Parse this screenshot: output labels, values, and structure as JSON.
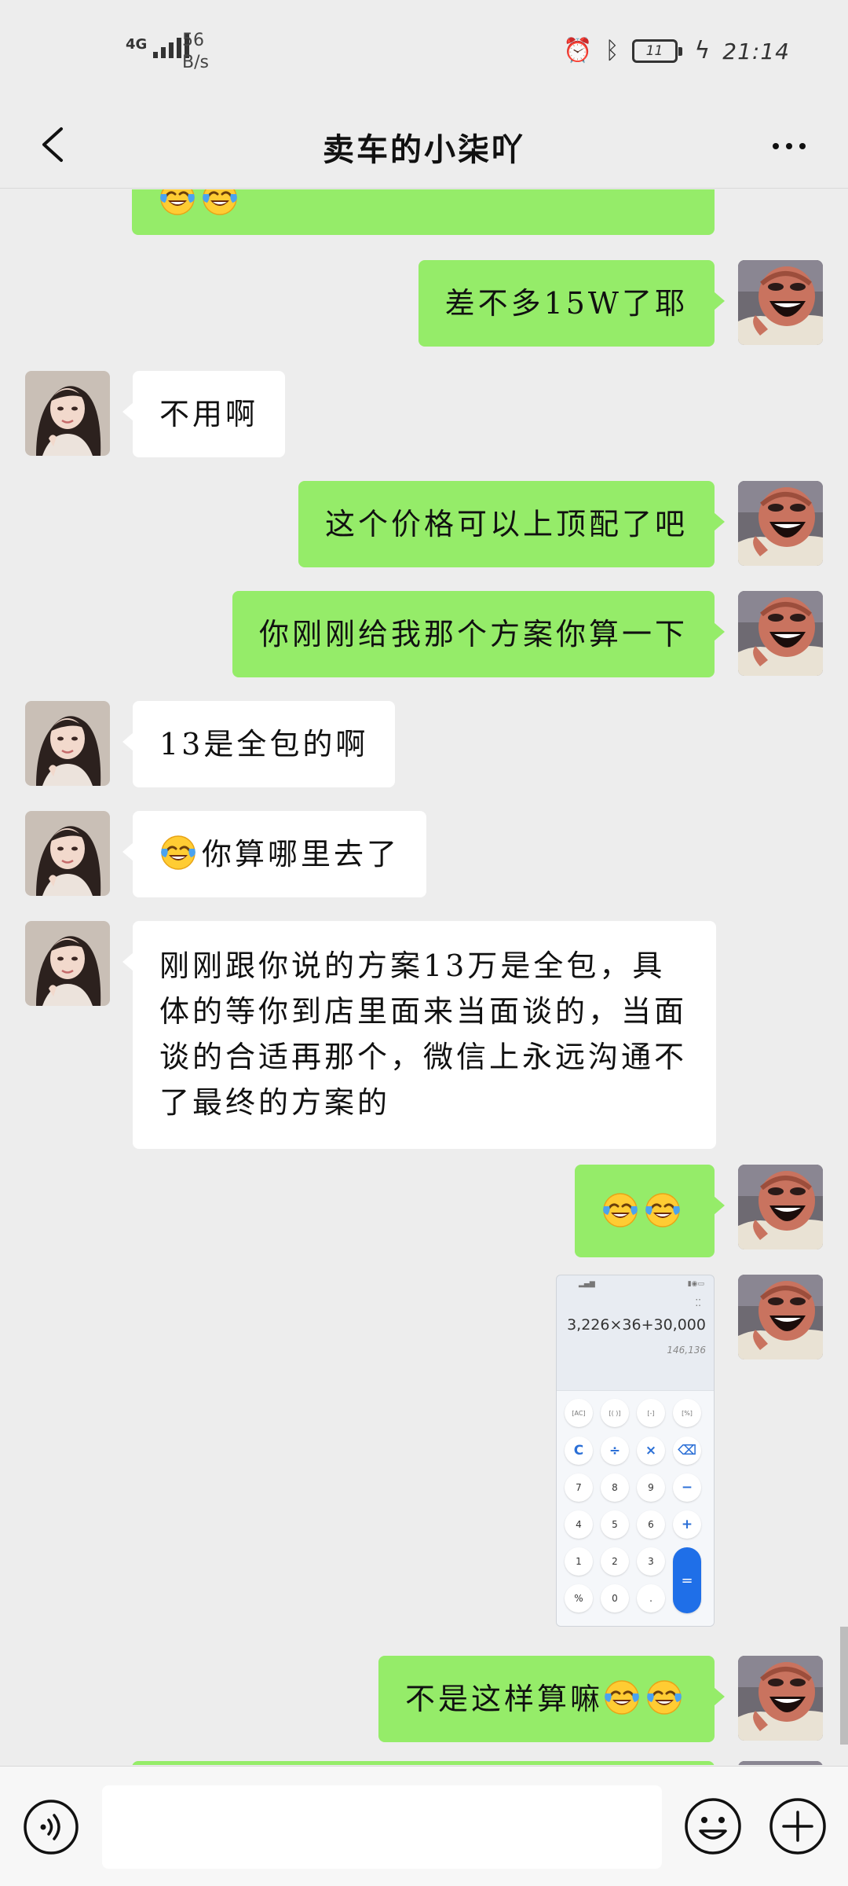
{
  "status_bar": {
    "network_type": "4G",
    "speed_value": "56",
    "speed_unit": "B/s",
    "battery_level": "11",
    "time": "21:14",
    "icons": [
      "signal-icon",
      "alarm-icon",
      "bluetooth-icon",
      "battery-icon",
      "charging-icon"
    ]
  },
  "header": {
    "title": "卖车的小柒吖",
    "back_icon": "chevron-left-icon",
    "more_icon": "more-dots-icon"
  },
  "messages": [
    {
      "side": "right",
      "type": "emoji",
      "emojis": [
        "tears-of-joy",
        "tears-of-joy"
      ],
      "partial": true
    },
    {
      "side": "right",
      "type": "text",
      "text": "差不多15W了耶"
    },
    {
      "side": "left",
      "type": "text",
      "text": "不用啊"
    },
    {
      "side": "right",
      "type": "text",
      "text": "这个价格可以上顶配了吧"
    },
    {
      "side": "right",
      "type": "text",
      "text": "你刚刚给我那个方案你算一下"
    },
    {
      "side": "left",
      "type": "text",
      "text": "13是全包的啊"
    },
    {
      "side": "left",
      "type": "text",
      "text": "你算哪里去了",
      "leading_emoji": "tears-of-joy"
    },
    {
      "side": "left",
      "type": "text",
      "text": "刚刚跟你说的方案13万是全包，具体的等你到店里面来当面谈的，当面谈的合适再那个，微信上永远沟通不了最终的方案的"
    },
    {
      "side": "right",
      "type": "emoji",
      "emojis": [
        "tears-of-joy",
        "tears-of-joy"
      ]
    },
    {
      "side": "right",
      "type": "image",
      "image": {
        "kind": "calculator-screenshot",
        "expression": "3,226×36+30,000",
        "result": "146,136",
        "keys": [
          [
            "AC",
            "( )",
            "%",
            "⌫"
          ],
          [
            "C",
            "÷",
            "×",
            "⌫"
          ],
          [
            "7",
            "8",
            "9",
            "−"
          ],
          [
            "4",
            "5",
            "6",
            "+"
          ],
          [
            "1",
            "2",
            "3",
            "="
          ],
          [
            "%",
            "0",
            ".",
            ""
          ]
        ],
        "top_keys": [
          "[AC]",
          "[( )]",
          "[-]",
          "[%]"
        ],
        "op_keys": [
          "C",
          "÷",
          "×",
          "⌫"
        ],
        "row7": [
          "7",
          "8",
          "9",
          "−"
        ],
        "row4": [
          "4",
          "5",
          "6",
          "+"
        ],
        "row1": [
          "1",
          "2",
          "3"
        ],
        "row0": [
          "%",
          "0",
          "."
        ],
        "equals": "="
      }
    },
    {
      "side": "right",
      "type": "text",
      "text": "不是这样算嘛",
      "trailing_emojis": [
        "tears-of-joy",
        "tears-of-joy"
      ]
    }
  ],
  "input_bar": {
    "voice_icon": "voice-icon",
    "emoji_icon": "emoji-icon",
    "plus_icon": "plus-icon",
    "input_value": "",
    "input_placeholder": ""
  },
  "colors": {
    "background": "#ededed",
    "bubble_self": "#95ec69",
    "bubble_other": "#ffffff",
    "calc_equals": "#1f6fe8"
  }
}
